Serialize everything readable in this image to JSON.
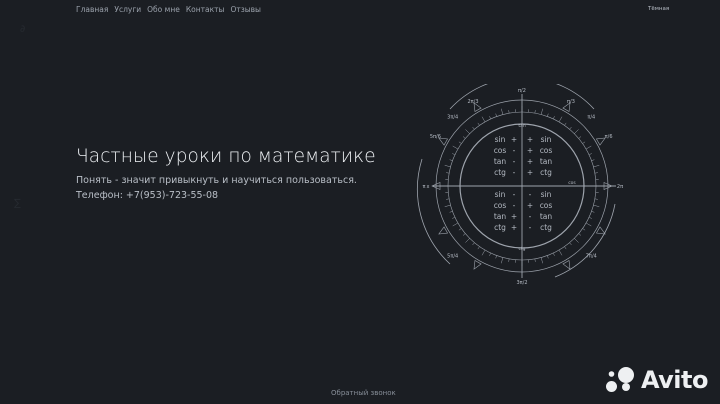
{
  "nav": {
    "items": [
      "Главная",
      "Услуги",
      "Обо мне",
      "Контакты",
      "Отзывы"
    ]
  },
  "theme_toggle": "Тёмная",
  "hero": {
    "title": "Частные уроки по математике",
    "subtitle": "Понять - значит привыкнуть и научиться пользоваться.",
    "phone": "Телефон: +7(953)-723-55-08"
  },
  "unit_circle": {
    "angle_labels": [
      "π/2",
      "3π/2",
      "π",
      "2π",
      "π/3",
      "2π/3",
      "π/6",
      "5π/6",
      "π/4",
      "3π/4",
      "7π/4",
      "5π/4"
    ],
    "quadrant_signs": {
      "top_left": [
        [
          "sin",
          "+"
        ],
        [
          "cos",
          "-"
        ],
        [
          "tan",
          "-"
        ],
        [
          "ctg",
          "-"
        ]
      ],
      "top_right": [
        [
          "+",
          "sin"
        ],
        [
          "+",
          "cos"
        ],
        [
          "+",
          "tan"
        ],
        [
          "+",
          "ctg"
        ]
      ],
      "bottom_left": [
        [
          "sin",
          "-"
        ],
        [
          "cos",
          "-"
        ],
        [
          "tan",
          "+"
        ],
        [
          "ctg",
          "+"
        ]
      ],
      "bottom_right": [
        [
          "-",
          "sin"
        ],
        [
          "+",
          "cos"
        ],
        [
          "-",
          "tan"
        ],
        [
          "-",
          "ctg"
        ]
      ]
    },
    "axis_labels": {
      "top": "tan",
      "bottom": "ctg",
      "right": "cos",
      "left_axis": "x"
    },
    "colors": {
      "line": "#9ea4ad",
      "text": "#b5bbc4"
    }
  },
  "callback_label": "Обратный звонок",
  "brand": {
    "name": "Avito",
    "dot_colors": [
      "#eef0f2",
      "#eef0f2",
      "#eef0f2",
      "#eef0f2"
    ]
  }
}
